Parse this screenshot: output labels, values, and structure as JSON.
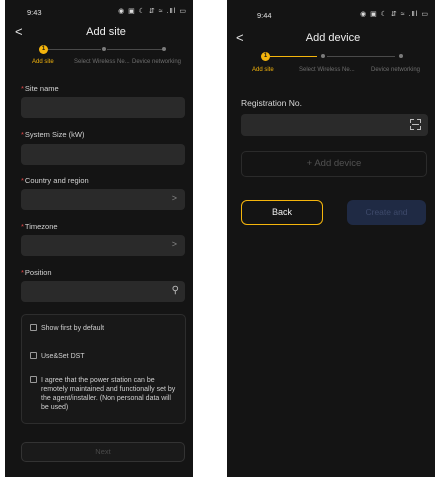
{
  "screen1": {
    "status": {
      "time": "9:43",
      "icons": "◉ ▣ ☾ ⇵ ≈ .Ⅱl ▭"
    },
    "nav": {
      "back": "<",
      "title": "Add site"
    },
    "steps": {
      "active_number": "1",
      "labels": [
        "Add site",
        "Select Wireless Ne...",
        "Device networking"
      ]
    },
    "fields": [
      {
        "label": "Site name",
        "value": "",
        "trailing": ""
      },
      {
        "label": "System Size (kW)",
        "value": "",
        "trailing": ""
      },
      {
        "label": "Country and region",
        "value": "",
        "trailing": "chevron"
      },
      {
        "label": "Timezone",
        "value": "",
        "trailing": "chevron"
      },
      {
        "label": "Position",
        "value": "",
        "trailing": "location"
      }
    ],
    "required_mark": "*",
    "options": [
      {
        "label": "Show first by default",
        "checked": false
      },
      {
        "label": "Use&Set DST",
        "checked": false
      },
      {
        "label": "I agree that the power station can be remotely maintained and functionally set by the agent/installer. (Non personal data will be used)",
        "checked": false
      }
    ],
    "next_button": "Next"
  },
  "screen2": {
    "status": {
      "time": "9:44",
      "icons": "◉ ▣ ☾ ⇵ ≈ .Ⅱl ▭"
    },
    "nav": {
      "back": "<",
      "title": "Add device"
    },
    "steps": {
      "active_number": "1",
      "labels": [
        "Add site",
        "Select Wireless Ne...",
        "Device networking"
      ]
    },
    "registration": {
      "label": "Registration No.",
      "value": ""
    },
    "add_device_button": "+ Add device",
    "back_button": "Back",
    "create_button": "Create and"
  },
  "colors": {
    "background": "#141414",
    "accent": "#f5b50c",
    "required": "#e04848",
    "field": "#2a2a2a",
    "disabled_primary": "#1f2a44"
  },
  "icons": {
    "back": "chevron-left-icon",
    "chevron": "chevron-right-icon",
    "location": "location-pin-icon",
    "scan": "scan-icon"
  }
}
